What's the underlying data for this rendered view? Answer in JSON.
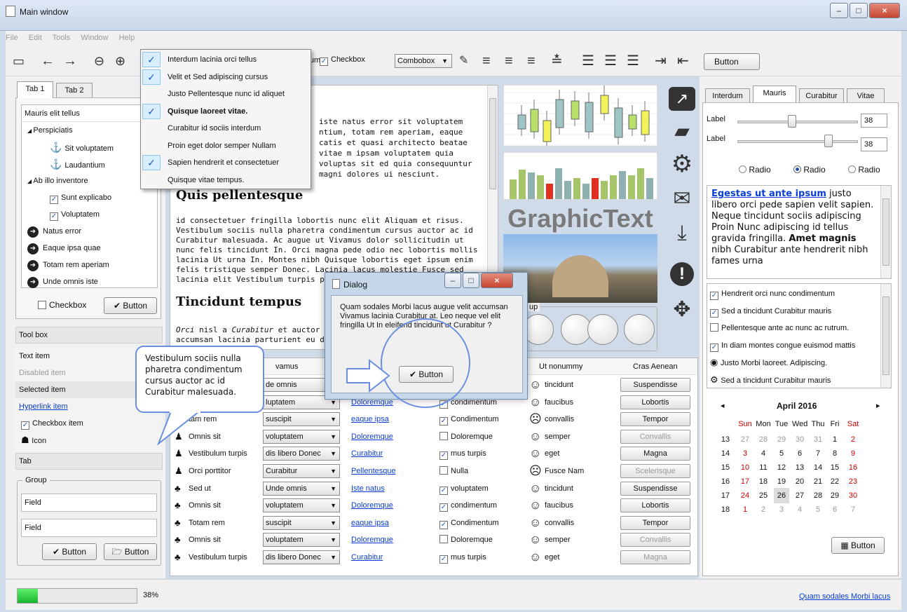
{
  "window": {
    "title": "Main window",
    "minimize": "–",
    "maximize": "□",
    "close": "×"
  },
  "menu": [
    "File",
    "Edit",
    "Tools",
    "Window",
    "Help"
  ],
  "toolbar": {
    "checkbox_label": "Checkbox",
    "interdum_label": "erdum",
    "combo": "Combobox",
    "button": "Button"
  },
  "left": {
    "tabs": [
      "Tab 1",
      "Tab 2"
    ],
    "tree_header": "Mauris elit tellus",
    "tree": [
      {
        "label": "Perspiciatis",
        "level": 1,
        "icon": "triangle-icon"
      },
      {
        "label": "Sit voluptatem",
        "level": 2,
        "icon": "anchor-icon"
      },
      {
        "label": "Laudantium",
        "level": 2,
        "icon": "anchor-icon"
      },
      {
        "label": "Ab illo inventore",
        "level": 1,
        "icon": "triangle-icon"
      },
      {
        "label": "Sunt explicabo",
        "level": 2,
        "icon": "checkbox"
      },
      {
        "label": "Voluptatem",
        "level": 2,
        "icon": "checkbox"
      },
      {
        "label": "Natus error",
        "level": 1,
        "icon": "arrow-circle-icon"
      },
      {
        "label": "Eaque ipsa quae",
        "level": 1,
        "icon": "arrow-circle-icon"
      },
      {
        "label": "Totam rem aperiam",
        "level": 1,
        "icon": "arrow-circle-icon"
      },
      {
        "label": "Unde omnis iste",
        "level": 1,
        "icon": "arrow-circle-icon"
      }
    ],
    "checkbox": "Checkbox",
    "button": "Button",
    "toolbox_title": "Tool box",
    "items": {
      "text": "Text item",
      "disabled": "Disabled item",
      "selected": "Selected item",
      "hyperlink": "Hyperlink item",
      "checkbox": "Checkbox item",
      "icon": "Icon"
    },
    "tab_label": "Tab",
    "group_label": "Group",
    "field1": "Field",
    "field2": "Field",
    "group_button1": "Button",
    "group_button2": "Button"
  },
  "context_menu": [
    {
      "label": "Interdum lacinia orci tellus",
      "checked": true,
      "bold": false
    },
    {
      "label": "Velit et Sed adipiscing cursus",
      "checked": true,
      "bold": false
    },
    {
      "label": "Justo Pellentesque nunc id aliquet",
      "checked": false,
      "bold": false
    },
    {
      "label": "Quisque laoreet vitae.",
      "checked": true,
      "bold": true
    },
    {
      "label": "Curabitur id sociis interdum",
      "checked": false,
      "bold": false
    },
    {
      "label": "Proin eget dolor semper Nullam",
      "checked": false,
      "bold": false
    },
    {
      "label": "Sapien hendrerit et consectetuer",
      "checked": true,
      "bold": false
    },
    {
      "label": "Quisque vitae tempus.",
      "checked": false,
      "bold": false
    }
  ],
  "text": {
    "para1": "iste natus error sit voluptatem ntium, totam rem aperiam, eaque catis et quasi architecto beatae vitae m ipsam voluptatem quia voluptas sit ed quia consequuntur magni dolores ui nesciunt.",
    "heading1": "Quis pellentesque",
    "para2": "id consectetuer fringilla lobortis nunc elit Aliquam et risus. Vestibulum sociis nulla pharetra condimentum cursus auctor ac id Curabitur malesuada. Ac augue ut Vivamus dolor sollicitudin ut nunc felis tincidunt In. Orci magna pede odio nec lobortis mollis lacinia Ut urna In. Montes nibh Quisque lobortis eget ipsum enim felis tristique semper Donec. Lacinia lacus molestie Fusce sed lacinia elit Vestibulum turpis pretium vitae. Ip",
    "heading2": "Tincidunt tempus",
    "para3_prefix": "Orci",
    "para3_mid1": " nisl a ",
    "para3_em": "Curabitur",
    "para3_rest": " et auctor risus",
    "para3_line2": "accumsan lacinia parturient eu dol"
  },
  "callout": "Vestibulum sociis nulla pharetra condimentum cursus auctor ac id Curabitur malesuada.",
  "dialog": {
    "title": "Dialog",
    "text": "Quam sodales Morbi lacus augue velit accumsan Vivamus lacinia Curabitur at. Leo neque vel elit fringilla Ut In eleifend tincidunt ut Curabitur ?",
    "button": "Button"
  },
  "graphic_text": "GraphicText",
  "dials_label": "up",
  "table": {
    "headers": [
      "vamus",
      "Ut nonummy",
      "Cras Aenean"
    ],
    "rows": [
      {
        "name": "",
        "combo": "de omnis",
        "link": "",
        "check": "",
        "checked": false,
        "smile": "tincidunt",
        "sad": false,
        "btn": "Suspendisse",
        "disabled": false
      },
      {
        "name": "",
        "combo": "luptatem",
        "link": "Doloremque",
        "check": "condimentum",
        "checked": true,
        "smile": "faucibus",
        "sad": false,
        "btn": "Lobortis",
        "disabled": false
      },
      {
        "name": "tam rem",
        "combo": "suscipit",
        "link": "eaque ipsa",
        "check": "Condimentum",
        "checked": true,
        "smile": "convallis",
        "sad": true,
        "btn": "Tempor",
        "disabled": false
      },
      {
        "name": "Omnis sit",
        "combo": "voluptatem",
        "link": "Doloremque",
        "check": "Doloremque",
        "checked": false,
        "smile": "semper",
        "sad": false,
        "btn": "Convallis",
        "disabled": true
      },
      {
        "name": "Vestibulum turpis",
        "combo": "dis libero Donec",
        "link": "Curabitur",
        "check": "mus turpis",
        "checked": true,
        "smile": "eget",
        "sad": false,
        "btn": "Magna",
        "disabled": false
      },
      {
        "name": "Orci porttitor",
        "combo": "Curabitur",
        "link": "Pellentesque",
        "check": "Nulla",
        "checked": false,
        "smile": "Fusce Nam",
        "sad": true,
        "btn": "Scelerisque",
        "disabled": true
      },
      {
        "name": "Sed ut",
        "combo": "Unde omnis",
        "link": "Iste natus",
        "check": "voluptatem",
        "checked": true,
        "smile": "tincidunt",
        "sad": false,
        "btn": "Suspendisse",
        "disabled": false
      },
      {
        "name": "Omnis sit",
        "combo": "voluptatem",
        "link": "Doloremque",
        "check": "condimentum",
        "checked": true,
        "smile": "faucibus",
        "sad": false,
        "btn": "Lobortis",
        "disabled": false
      },
      {
        "name": "Totam rem",
        "combo": "suscipit",
        "link": "eaque ipsa",
        "check": "Condimentum",
        "checked": true,
        "smile": "convallis",
        "sad": false,
        "btn": "Tempor",
        "disabled": false
      },
      {
        "name": "Omnis sit",
        "combo": "voluptatem",
        "link": "Doloremque",
        "check": "Doloremque",
        "checked": false,
        "smile": "semper",
        "sad": false,
        "btn": "Convallis",
        "disabled": true
      },
      {
        "name": "Vestibulum turpis",
        "combo": "dis libero Donec",
        "link": "Curabitur",
        "check": "mus turpis",
        "checked": true,
        "smile": "eget",
        "sad": false,
        "btn": "Magna",
        "disabled": true
      }
    ]
  },
  "right": {
    "tabs": [
      "Interdum",
      "Mauris",
      "Curabitur",
      "Vitae"
    ],
    "slider1": {
      "label": "Label",
      "value": "38",
      "level": 0.45
    },
    "slider2": {
      "label": "Label",
      "value": "38",
      "level": 0.75
    },
    "radios": [
      "Radio",
      "Radio",
      "Radio"
    ],
    "rich_link": "Egestas ut ante ipsum",
    "rich_1": " justo libero orci pede sapien velit sapien. Neque tincidunt sociis adipiscing Proin Nunc adipiscing id tellus gravida fringilla. ",
    "rich_bold": "Amet magnis",
    "rich_2": " nibh Curabitur ante hendrerit nibh fames urna",
    "checklist": [
      {
        "label": "Hendrerit orci nunc condimentum",
        "type": "check",
        "checked": true
      },
      {
        "label": "Sed a tincidunt Curabitur mauris",
        "type": "check",
        "checked": true
      },
      {
        "label": "Pellentesque ante ac nunc ac rutrum.",
        "type": "check",
        "checked": false
      },
      {
        "label": "In diam montes congue euismod mattis",
        "type": "check",
        "checked": true
      },
      {
        "label": "Justo Morbi laoreet. Adipiscing.",
        "type": "icon",
        "icon": "compass-icon"
      },
      {
        "label": "Sed a tincidunt Curabitur mauris",
        "type": "icon",
        "icon": "gear-icon"
      }
    ],
    "calendar": {
      "title": "April 2016",
      "prev": "◂",
      "next": "▸",
      "days": [
        "Sun",
        "Mon",
        "Tue",
        "Wed",
        "Thu",
        "Fri",
        "Sat"
      ],
      "weeks": [
        [
          "13",
          "27",
          "28",
          "29",
          "30",
          "31",
          "1",
          "2"
        ],
        [
          "14",
          "3",
          "4",
          "5",
          "6",
          "7",
          "8",
          "9"
        ],
        [
          "15",
          "10",
          "11",
          "12",
          "13",
          "14",
          "15",
          "16"
        ],
        [
          "16",
          "17",
          "18",
          "19",
          "20",
          "21",
          "22",
          "23"
        ],
        [
          "17",
          "24",
          "25",
          "26",
          "27",
          "28",
          "29",
          "30"
        ],
        [
          "18",
          "1",
          "2",
          "3",
          "4",
          "5",
          "6",
          "7"
        ]
      ]
    },
    "cal_button": "Button"
  },
  "side_icons": [
    "external-link-icon",
    "folder-open-icon",
    "gear-icon",
    "envelope-icon",
    "download-icon",
    "exclamation-icon",
    "expand-icon"
  ],
  "status": {
    "progress": 0.38,
    "progress_text": "38%",
    "link": "Quam sodales Morbi lacus"
  }
}
